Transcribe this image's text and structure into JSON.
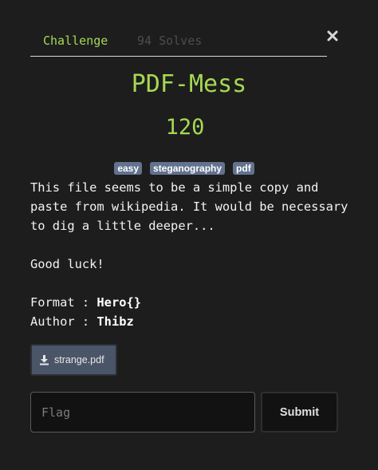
{
  "tabs": {
    "challenge_label": "Challenge",
    "solves_label": "94 Solves"
  },
  "close_icon": "close-icon",
  "challenge": {
    "name": "PDF-Mess",
    "points": "120",
    "tags": [
      "easy",
      "steganography",
      "pdf"
    ],
    "description": {
      "intro": "This file seems to be a simple copy and paste from wikipedia. It would be necessary to dig a little deeper...",
      "good_luck": "Good luck!",
      "format_label": "Format : ",
      "format_value": "Hero{}",
      "author_label": "Author : ",
      "author_value": "Thibz"
    },
    "file": {
      "name": "strange.pdf",
      "icon": "download-icon"
    }
  },
  "form": {
    "flag_placeholder": "Flag",
    "flag_value": "",
    "submit_label": "Submit"
  },
  "colors": {
    "accent": "#a6d854",
    "tag_bg": "#62728f",
    "background": "#1d1d1d"
  }
}
